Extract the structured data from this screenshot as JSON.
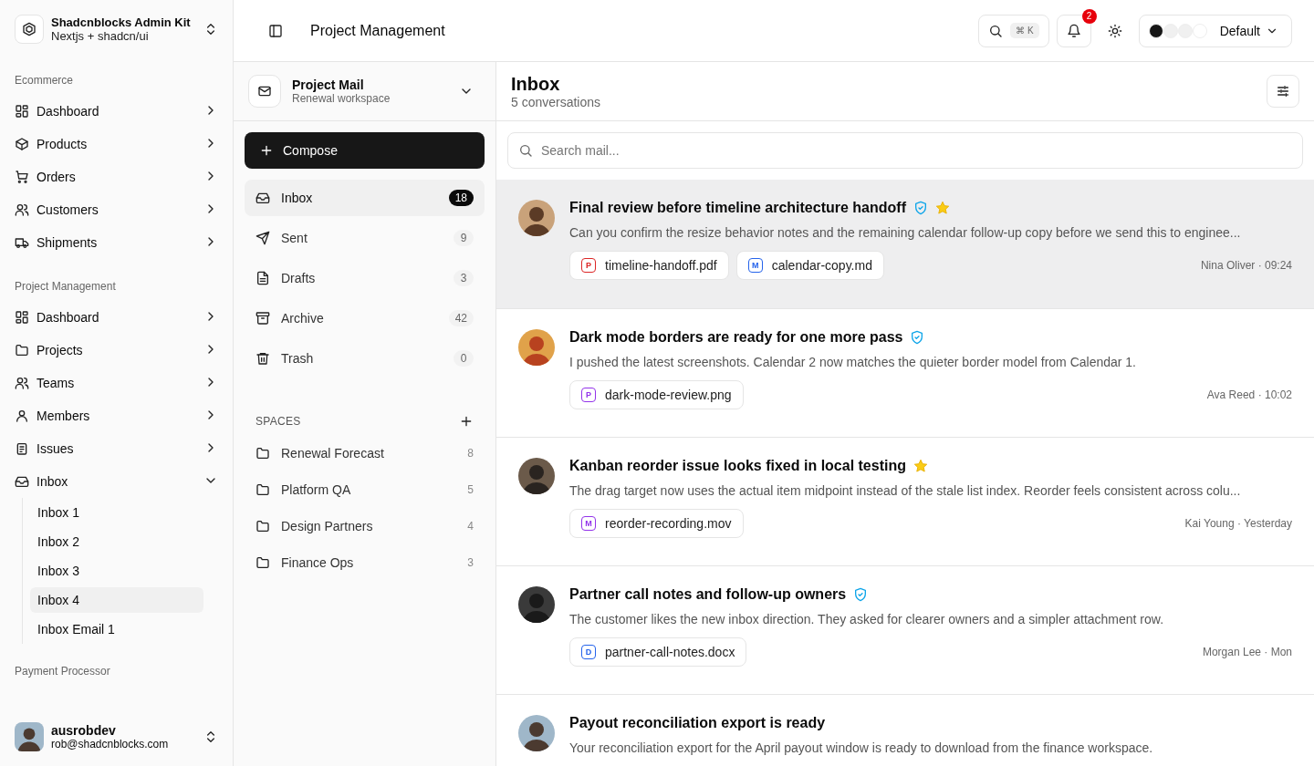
{
  "sidebar": {
    "brand": {
      "title": "Shadcnblocks Admin Kit",
      "subtitle": "Nextjs + shadcn/ui"
    },
    "sections": [
      {
        "label": "Ecommerce",
        "items": [
          {
            "label": "Dashboard",
            "expanded": false
          },
          {
            "label": "Products",
            "expanded": false
          },
          {
            "label": "Orders",
            "expanded": false
          },
          {
            "label": "Customers",
            "expanded": false
          },
          {
            "label": "Shipments",
            "expanded": false
          }
        ]
      },
      {
        "label": "Project Management",
        "items": [
          {
            "label": "Dashboard",
            "expanded": false
          },
          {
            "label": "Projects",
            "expanded": false
          },
          {
            "label": "Teams",
            "expanded": false
          },
          {
            "label": "Members",
            "expanded": false
          },
          {
            "label": "Issues",
            "expanded": false
          },
          {
            "label": "Inbox",
            "expanded": true,
            "children": [
              {
                "label": "Inbox 1",
                "selected": false
              },
              {
                "label": "Inbox 2",
                "selected": false
              },
              {
                "label": "Inbox 3",
                "selected": false
              },
              {
                "label": "Inbox 4",
                "selected": true
              },
              {
                "label": "Inbox Email 1",
                "selected": false
              }
            ]
          }
        ]
      },
      {
        "label": "Payment Processor"
      }
    ],
    "user": {
      "name": "ausrobdev",
      "email": "rob@shadcnblocks.com"
    }
  },
  "header": {
    "title": "Project Management",
    "shortcut": "⌘ K",
    "notifications": "2",
    "theme": {
      "label": "Default",
      "swatches": [
        {
          "color": "#171717"
        },
        {
          "color": "#f0f0f0"
        },
        {
          "color": "#f0f0f0"
        },
        {
          "color": "#ffffff"
        }
      ]
    }
  },
  "mail_panel": {
    "account": {
      "name": "Project Mail",
      "subtitle": "Renewal workspace"
    },
    "compose": "Compose",
    "folders": [
      {
        "label": "Inbox",
        "count": "18",
        "selected": true
      },
      {
        "label": "Sent",
        "count": "9",
        "selected": false
      },
      {
        "label": "Drafts",
        "count": "3",
        "selected": false
      },
      {
        "label": "Archive",
        "count": "42",
        "selected": false
      },
      {
        "label": "Trash",
        "count": "0",
        "selected": false
      }
    ],
    "spaces_heading": "SPACES",
    "spaces": [
      {
        "label": "Renewal Forecast",
        "count": "8"
      },
      {
        "label": "Platform QA",
        "count": "5"
      },
      {
        "label": "Design Partners",
        "count": "4"
      },
      {
        "label": "Finance Ops",
        "count": "3"
      }
    ]
  },
  "inbox": {
    "title": "Inbox",
    "subtitle": "5 conversations",
    "search": {
      "placeholder": "Search mail..."
    },
    "messages": [
      {
        "subject": "Final review before timeline architecture handoff",
        "verified": true,
        "starred": true,
        "selected": true,
        "preview": "Can you confirm the resize behavior notes and the remaining calendar follow-up copy before we send this to enginee...",
        "attachments": [
          {
            "letter": "P",
            "name": "timeline-handoff.pdf",
            "color": "#dc2626"
          },
          {
            "letter": "M",
            "name": "calendar-copy.md",
            "color": "#2563eb"
          }
        ],
        "meta": "Nina Oliver · 09:24"
      },
      {
        "subject": "Dark mode borders are ready for one more pass",
        "verified": true,
        "starred": false,
        "selected": false,
        "preview": "I pushed the latest screenshots. Calendar 2 now matches the quieter border model from Calendar 1.",
        "attachments": [
          {
            "letter": "P",
            "name": "dark-mode-review.png",
            "color": "#9333ea"
          }
        ],
        "meta": "Ava Reed · 10:02"
      },
      {
        "subject": "Kanban reorder issue looks fixed in local testing",
        "verified": false,
        "starred": true,
        "selected": false,
        "preview": "The drag target now uses the actual item midpoint instead of the stale list index. Reorder feels consistent across colu...",
        "attachments": [
          {
            "letter": "M",
            "name": "reorder-recording.mov",
            "color": "#9333ea"
          }
        ],
        "meta": "Kai Young · Yesterday"
      },
      {
        "subject": "Partner call notes and follow-up owners",
        "verified": true,
        "starred": false,
        "selected": false,
        "preview": "The customer likes the new inbox direction. They asked for clearer owners and a simpler attachment row.",
        "attachments": [
          {
            "letter": "D",
            "name": "partner-call-notes.docx",
            "color": "#2563eb"
          }
        ],
        "meta": "Morgan Lee · Mon"
      },
      {
        "subject": "Payout reconciliation export is ready",
        "verified": false,
        "starred": false,
        "selected": false,
        "preview": "Your reconciliation export for the April payout window is ready to download from the finance workspace."
      }
    ]
  }
}
